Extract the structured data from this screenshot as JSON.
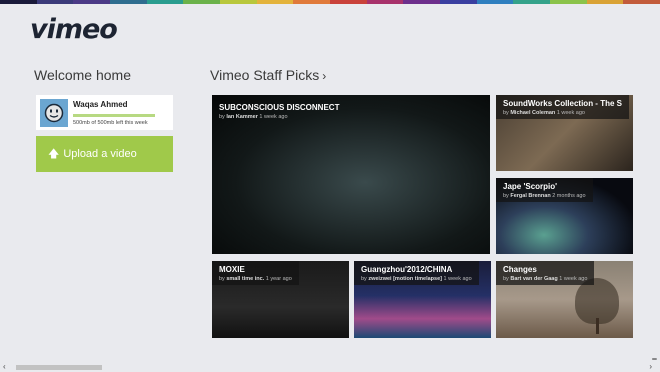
{
  "stripe_colors": [
    "#1a1a3a",
    "#3b3b7a",
    "#4b3a86",
    "#2f6d8f",
    "#2a9d8f",
    "#6bb24a",
    "#b8c73c",
    "#e3b33b",
    "#e07a3a",
    "#c9423a",
    "#a8326b",
    "#6d2f8c",
    "#3a3fa0",
    "#2f7fbf",
    "#34a28a",
    "#8bc34a",
    "#d9a235",
    "#c25b3a"
  ],
  "app": {
    "logo": "vimeo"
  },
  "welcome": {
    "title": "Welcome home",
    "user_name": "Waqas Ahmed",
    "quota_text": "500mb of 500mb left this week",
    "quota_fraction": 1.0,
    "upload_label": "Upload a video"
  },
  "staff_picks": {
    "title": "Vimeo Staff Picks",
    "chevron": "›",
    "tiles": [
      {
        "title": "SUBCONSCIOUS DISCONNECT",
        "by": "by",
        "author": "Ian Kammer",
        "time": "1 week ago"
      },
      {
        "title": "SoundWorks Collection - The S",
        "by": "by",
        "author": "Michael Coleman",
        "time": "1 week ago"
      },
      {
        "title": "Jape 'Scorpio'",
        "by": "by",
        "author": "Fergal Brennan",
        "time": "2 months ago"
      },
      {
        "title": "MOXIE",
        "by": "by",
        "author": "small time inc.",
        "time": "1 year ago"
      },
      {
        "title": "Guangzhou'2012/CHINA",
        "by": "by",
        "author": "zweizwei [motion timelapse]",
        "time": "1 week ago"
      },
      {
        "title": "Changes",
        "by": "by",
        "author": "Bart van der Gaag",
        "time": "1 week ago"
      }
    ]
  },
  "scrollbar": {
    "left_arrow": "‹",
    "right_arrow": "›",
    "minus": "−"
  }
}
